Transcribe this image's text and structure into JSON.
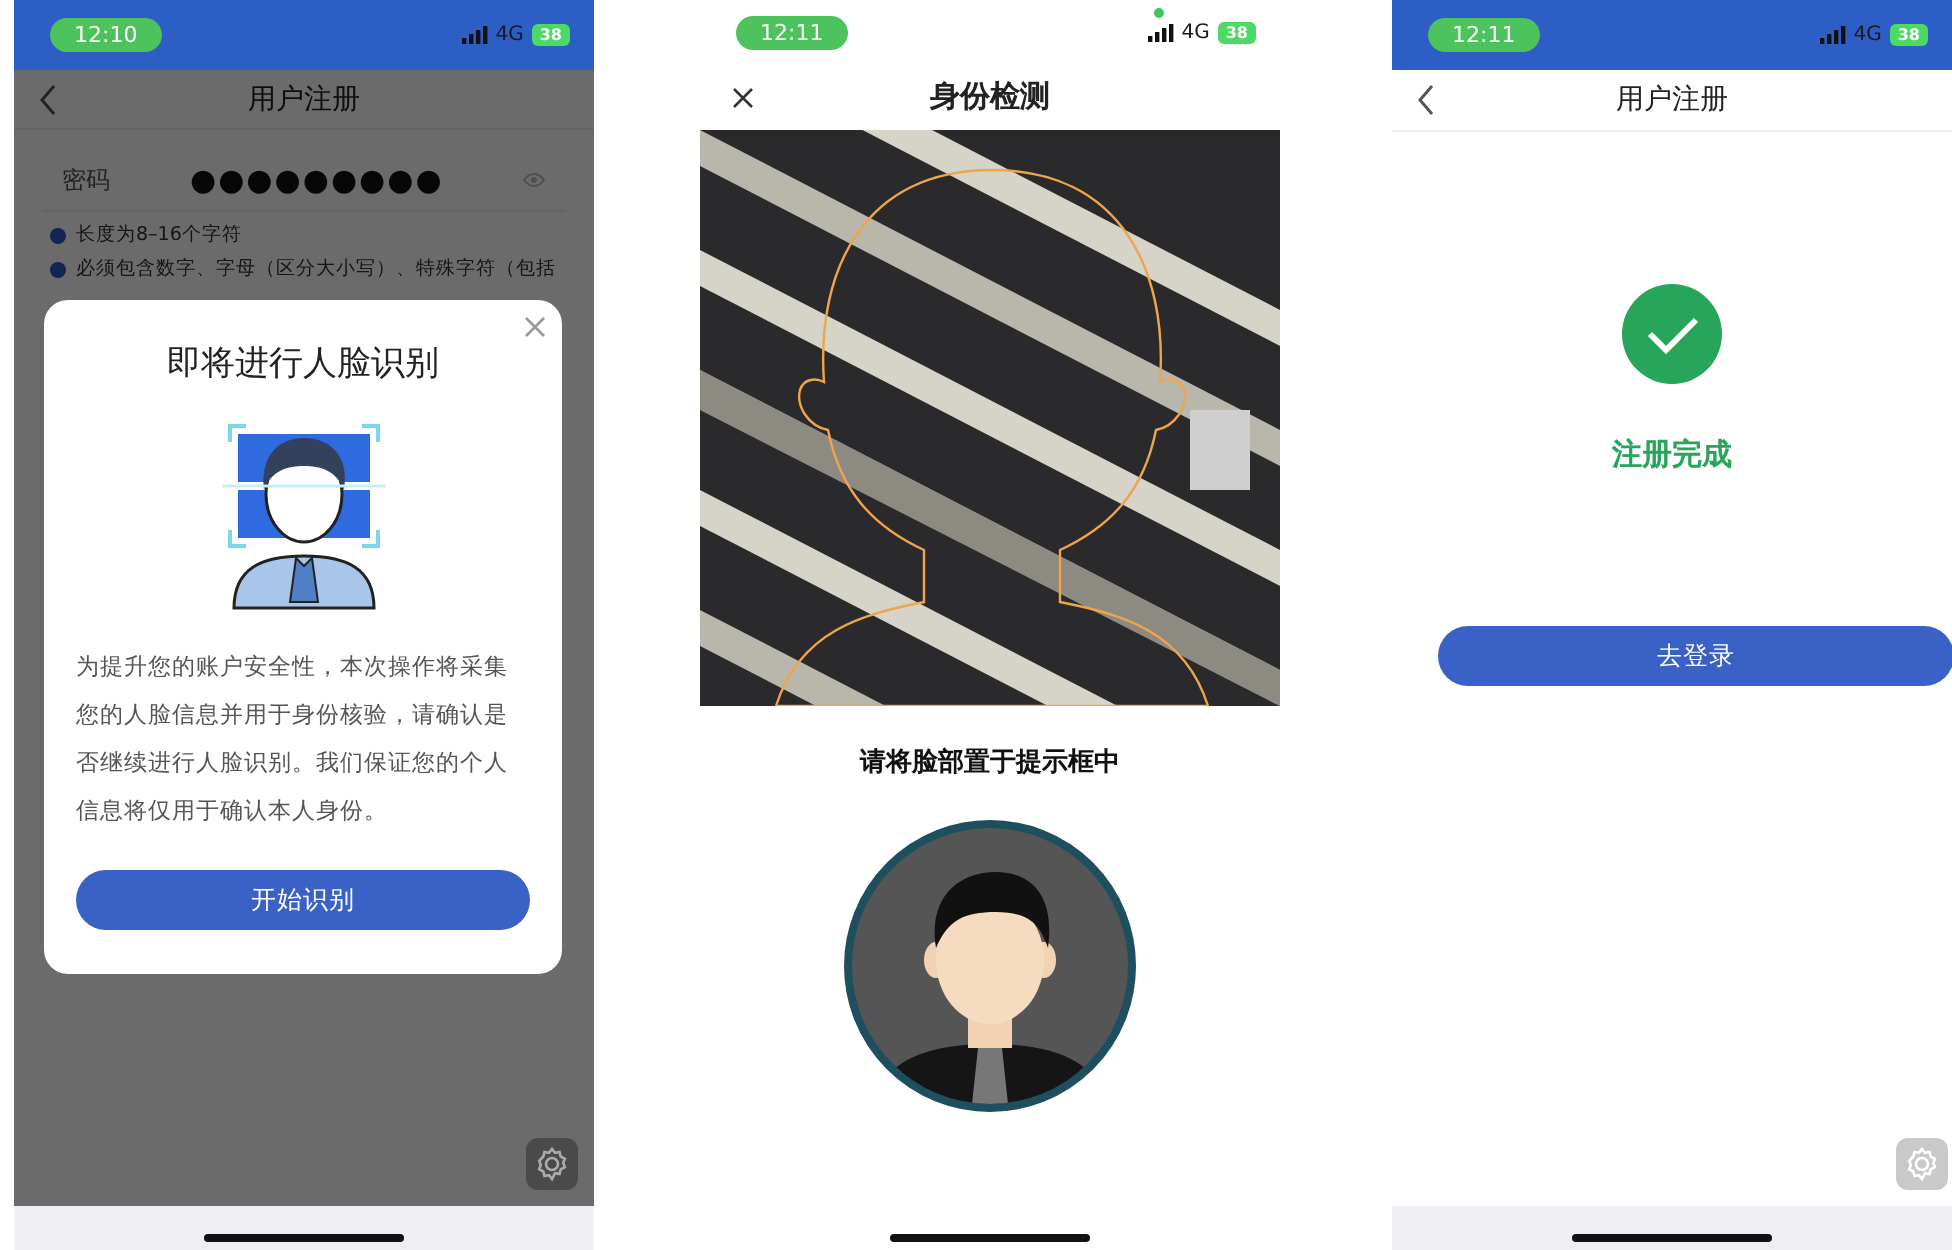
{
  "screens": [
    {
      "kind": "consent",
      "status_bar": {
        "time": "12:10",
        "network": "4G",
        "battery": "38"
      },
      "title": "用户注册",
      "password": {
        "label": "密码",
        "value": "●●●●●●●●●"
      },
      "hints": [
        "长度为8–16个字符",
        "必须包含数字、字母（区分大小写）、特殊字符（包括"
      ],
      "dialog": {
        "title": "即将进行人脸识别",
        "text": "为提升您的账户安全性，本次操作将采集您的人脸信息并用于身份核验，请确认是否继续进行人脸识别。我们保证您的个人信息将仅用于确认本人身份。",
        "button": "开始识别"
      }
    },
    {
      "kind": "camera",
      "status_bar": {
        "time": "12:11",
        "network": "4G",
        "battery": "38"
      },
      "title": "身份检测",
      "prompt": "请将脸部置于提示框中"
    },
    {
      "kind": "done",
      "status_bar": {
        "time": "12:11",
        "network": "4G",
        "battery": "38"
      },
      "title": "用户注册",
      "message": "注册完成",
      "button": "去登录"
    }
  ]
}
